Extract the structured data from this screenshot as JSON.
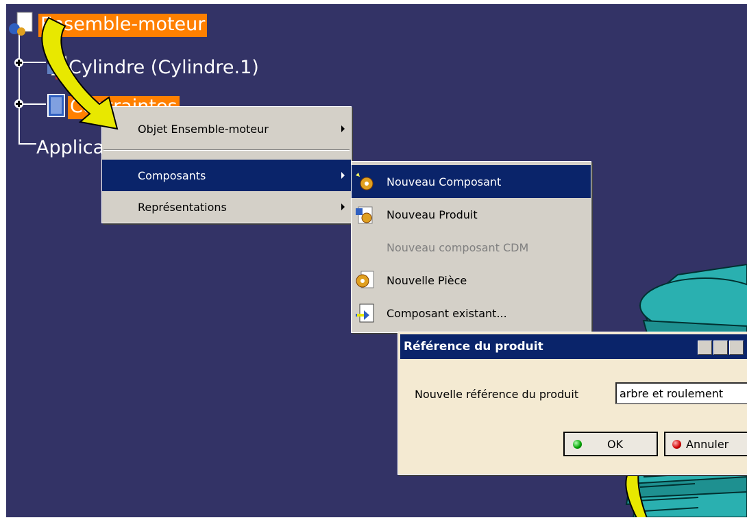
{
  "tree": {
    "root_label": "Ensemble-moteur",
    "child1_label": "Cylindre (Cylindre.1)",
    "child2_label": "Contraintes",
    "child3_label": "Applica"
  },
  "context_menu": {
    "items": [
      {
        "label": "Objet Ensemble-moteur"
      },
      {
        "label": "Composants"
      },
      {
        "label": "Représentations"
      }
    ]
  },
  "submenu": {
    "items": [
      {
        "label": "Nouveau Composant",
        "icon": "new-component-icon"
      },
      {
        "label": "Nouveau Produit",
        "icon": "new-product-icon"
      },
      {
        "label": "Nouveau composant CDM",
        "icon": ""
      },
      {
        "label": "Nouvelle Pièce",
        "icon": "new-part-icon"
      },
      {
        "label": "Composant existant...",
        "icon": "existing-component-icon"
      }
    ]
  },
  "dialog": {
    "title": "Référence du produit",
    "field_label": "Nouvelle référence du produit",
    "field_value": "arbre et roulement",
    "ok_label": "OK",
    "cancel_label": "Annuler"
  },
  "colors": {
    "background": "#333366",
    "highlight": "#ff8000",
    "menu_selection": "#0a246a",
    "teal_part": "#2ab0b0",
    "callout_arrow": "#e8e800"
  }
}
